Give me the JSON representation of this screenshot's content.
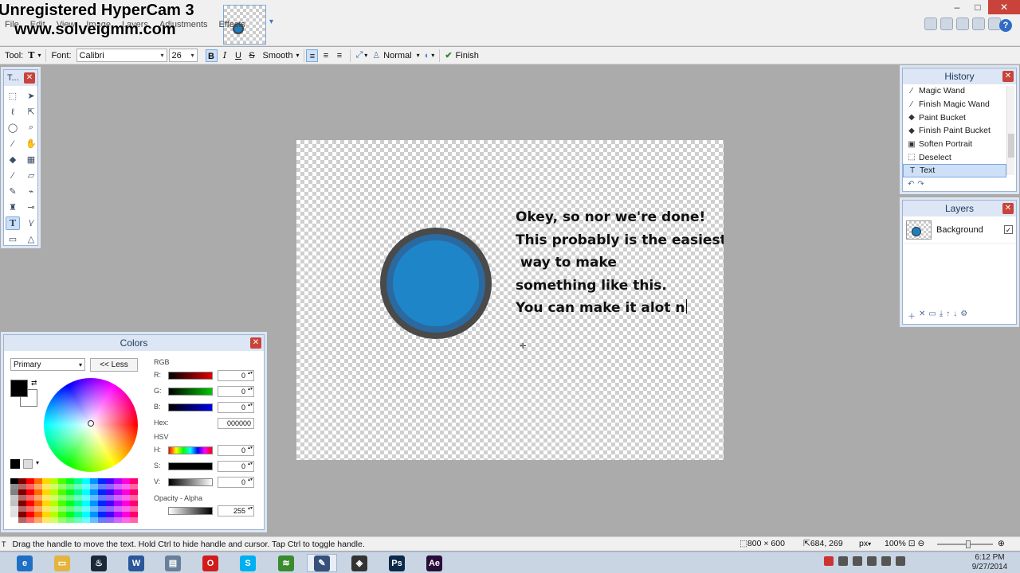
{
  "watermark": {
    "line1": "Unregistered HyperCam 3",
    "line2": "www.solveigmm.com"
  },
  "menu": [
    "File",
    "Edit",
    "View",
    "Image",
    "Layers",
    "Adjustments",
    "Effects"
  ],
  "toolbar": {
    "tool_label": "Tool:",
    "tool_value": "T",
    "font_label": "Font:",
    "font_value": "Calibri",
    "size_value": "26",
    "bold": "B",
    "italic": "I",
    "underline": "U",
    "strike": "S",
    "antialias": "Smooth",
    "blend_mode": "Normal",
    "finish_label": "Finish"
  },
  "canvas": {
    "text_lines": [
      "Okey, so nor we're done!",
      "This probably is the easiest",
      " way to make",
      "something like this.",
      "You can make it alot n"
    ],
    "circle_color": "#1e86c8"
  },
  "tools_window": {
    "title": "T..."
  },
  "history": {
    "title": "History",
    "items": [
      {
        "label": "Magic Wand",
        "icon": "magic-wand-icon",
        "glyph": "⁄"
      },
      {
        "label": "Finish Magic Wand",
        "icon": "magic-wand-icon",
        "glyph": "⁄"
      },
      {
        "label": "Paint Bucket",
        "icon": "paint-bucket-icon",
        "glyph": "◆"
      },
      {
        "label": "Finish Paint Bucket",
        "icon": "paint-bucket-icon",
        "glyph": "◆"
      },
      {
        "label": "Soften Portrait",
        "icon": "portrait-icon",
        "glyph": "▣"
      },
      {
        "label": "Deselect",
        "icon": "deselect-icon",
        "glyph": "⬚"
      },
      {
        "label": "Text",
        "icon": "text-icon",
        "glyph": "T"
      }
    ]
  },
  "layers": {
    "title": "Layers",
    "items": [
      {
        "label": "Background",
        "visible": true
      }
    ]
  },
  "colors": {
    "title": "Colors",
    "mode_select": "Primary",
    "less_button": "<< Less",
    "rgb_label": "RGB",
    "r_label": "R:",
    "g_label": "G:",
    "b_label": "B:",
    "r": "0",
    "g": "0",
    "b": "0",
    "hex_label": "Hex:",
    "hex": "000000",
    "hsv_label": "HSV",
    "h_label": "H:",
    "s_label": "S:",
    "v_label": "V:",
    "h": "0",
    "s": "0",
    "v": "0",
    "opacity_label": "Opacity - Alpha",
    "alpha": "255"
  },
  "status": {
    "hint": "Drag the handle to move the text. Hold Ctrl to hide handle and cursor. Tap Ctrl to toggle handle.",
    "image_size": "800 × 600",
    "cursor_pos": "684, 269",
    "unit": "px",
    "zoom": "100%"
  },
  "taskbar": {
    "apps": [
      {
        "name": "ie-icon",
        "glyph": "e",
        "color": "#1f6fc4"
      },
      {
        "name": "explorer-icon",
        "glyph": "▭",
        "color": "#e3b540"
      },
      {
        "name": "steam-icon",
        "glyph": "♨",
        "color": "#1b2838"
      },
      {
        "name": "word-icon",
        "glyph": "W",
        "color": "#2b579a"
      },
      {
        "name": "app-icon",
        "glyph": "▤",
        "color": "#6a7f99"
      },
      {
        "name": "opera-icon",
        "glyph": "O",
        "color": "#d21c1c"
      },
      {
        "name": "skype-icon",
        "glyph": "S",
        "color": "#00aff0"
      },
      {
        "name": "spotify-icon",
        "glyph": "≋",
        "color": "#3a8a2e"
      },
      {
        "name": "paintnet-icon",
        "glyph": "✎",
        "color": "#36507a"
      },
      {
        "name": "unity-icon",
        "glyph": "◈",
        "color": "#333333"
      },
      {
        "name": "photoshop-icon",
        "glyph": "Ps",
        "color": "#0b2a4a"
      },
      {
        "name": "aftereffects-icon",
        "glyph": "Ae",
        "color": "#2a0d3a"
      }
    ],
    "time": "6:12 PM",
    "date": "9/27/2014"
  }
}
